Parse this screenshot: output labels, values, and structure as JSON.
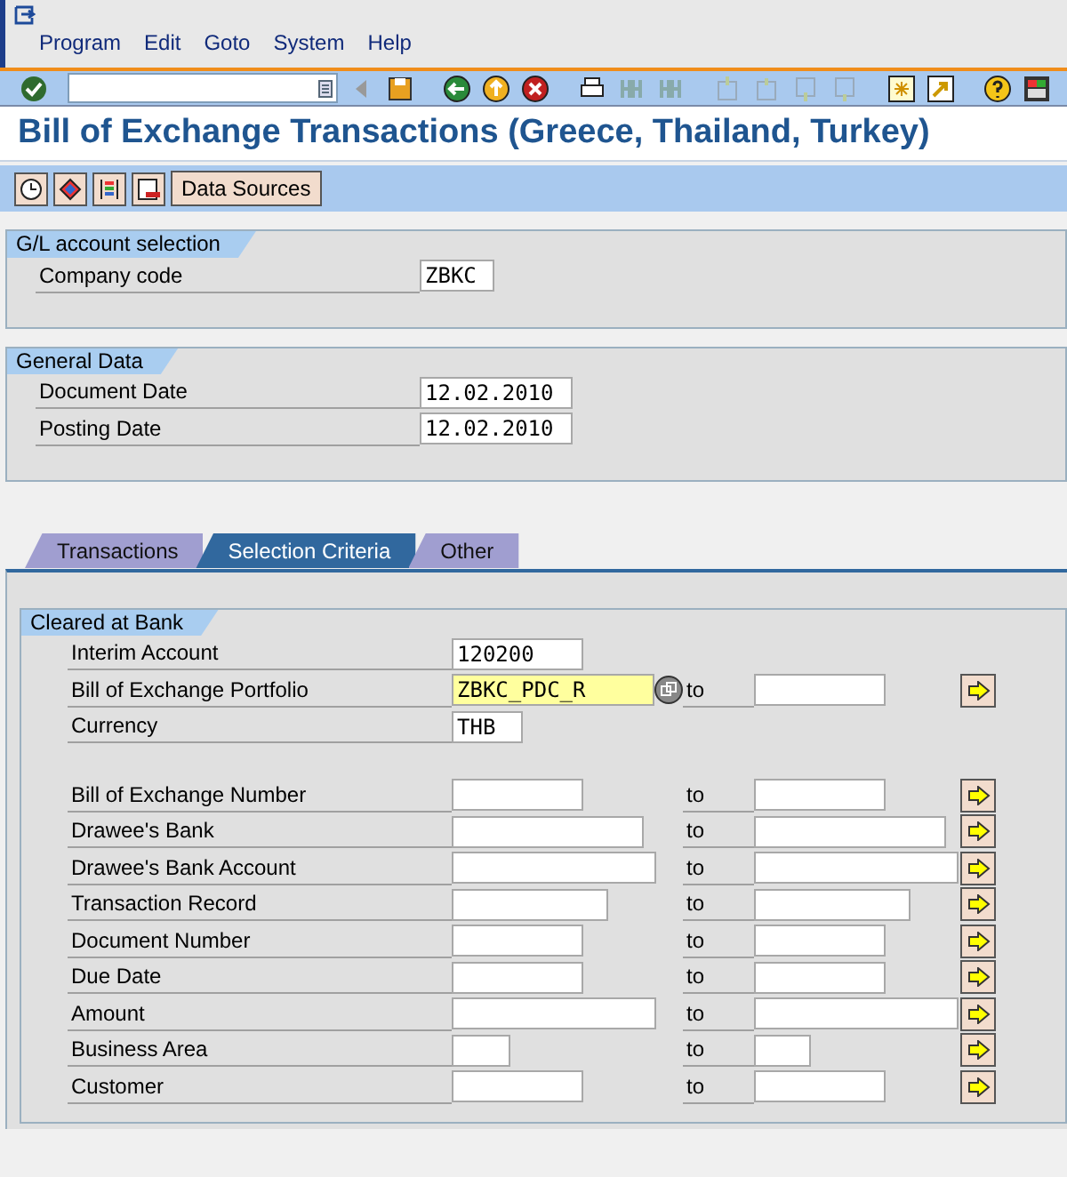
{
  "menu": [
    "Program",
    "Edit",
    "Goto",
    "System",
    "Help"
  ],
  "title": "Bill of Exchange Transactions (Greece, Thailand, Turkey)",
  "app_toolbar": {
    "button": "Data Sources"
  },
  "groups": [
    {
      "title": "G/L account selection",
      "fields": [
        {
          "label": "Company code",
          "value": "ZBKC"
        }
      ]
    },
    {
      "title": "General Data",
      "fields": [
        {
          "label": "Document Date",
          "value": "12.02.2010"
        },
        {
          "label": "Posting Date",
          "value": "12.02.2010"
        }
      ]
    }
  ],
  "tabs": [
    {
      "label": "Transactions",
      "selected": false
    },
    {
      "label": "Selection Criteria",
      "selected": true
    },
    {
      "label": "Other",
      "selected": false
    }
  ],
  "cleared_at_bank": {
    "title": "Cleared at Bank",
    "rows": [
      {
        "kind": "single",
        "label": "Interim Account",
        "value": "120200",
        "highlighted": false
      },
      {
        "kind": "range",
        "label": "Bill of Exchange Portfolio",
        "value": "ZBKC_PDC_R",
        "highlighted": true,
        "to": "to"
      },
      {
        "kind": "single",
        "label": "Currency",
        "value": "THB",
        "highlighted": false
      }
    ],
    "more_rows": [
      {
        "kind": "range",
        "label": "Bill of Exchange Number",
        "highlighted": false,
        "to": "to"
      },
      {
        "kind": "range",
        "label": "Drawee's Bank",
        "highlighted": false,
        "to": "to"
      },
      {
        "kind": "range",
        "label": "Drawee's Bank Account",
        "highlighted": false,
        "to": "to"
      },
      {
        "kind": "range",
        "label": "Transaction Record",
        "highlighted": false,
        "to": "to"
      },
      {
        "kind": "range",
        "label": "Document Number",
        "highlighted": false,
        "to": "to"
      },
      {
        "kind": "range",
        "label": "Due Date",
        "highlighted": false,
        "to": "to"
      },
      {
        "kind": "range",
        "label": "Amount",
        "highlighted": false,
        "to": "to"
      },
      {
        "kind": "range",
        "label": "Business Area",
        "highlighted": false,
        "to": "to"
      },
      {
        "kind": "range",
        "label": "Customer",
        "highlighted": false,
        "to": "to"
      }
    ]
  }
}
